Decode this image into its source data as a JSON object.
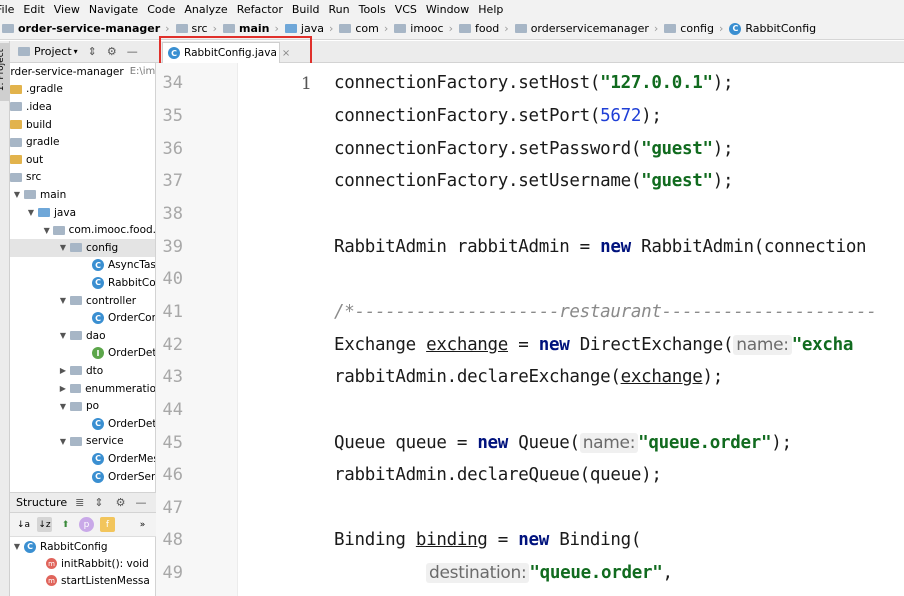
{
  "menu": [
    "File",
    "Edit",
    "View",
    "Navigate",
    "Code",
    "Analyze",
    "Refactor",
    "Build",
    "Run",
    "Tools",
    "VCS",
    "Window",
    "Help"
  ],
  "breadcrumb": [
    "order-service-manager",
    "src",
    "main",
    "java",
    "com",
    "imooc",
    "food",
    "orderservicemanager",
    "config",
    "RabbitConfig"
  ],
  "project": {
    "title": "Project",
    "root_name": "order-service-manager",
    "root_path": "E:\\imo",
    "tree": [
      {
        "label": ".gradle",
        "icon": "folder-orange"
      },
      {
        "label": ".idea",
        "icon": "folder-gray"
      },
      {
        "label": "build",
        "icon": "folder-orange"
      },
      {
        "label": "gradle",
        "icon": "folder-gray"
      },
      {
        "label": "out",
        "icon": "folder-orange"
      },
      {
        "label": "src",
        "icon": "folder-gray"
      },
      {
        "label": "main",
        "icon": "folder-gray"
      },
      {
        "label": "java",
        "icon": "folder-blue"
      },
      {
        "label": "com.imooc.food.",
        "icon": "package"
      },
      {
        "label": "config",
        "icon": "package"
      },
      {
        "label": "AsyncTask",
        "icon": "class"
      },
      {
        "label": "RabbitCor",
        "icon": "class"
      },
      {
        "label": "controller",
        "icon": "package"
      },
      {
        "label": "OrderCon",
        "icon": "class"
      },
      {
        "label": "dao",
        "icon": "package"
      },
      {
        "label": "OrderDeta",
        "icon": "interface"
      },
      {
        "label": "dto",
        "icon": "package"
      },
      {
        "label": "enummeratio",
        "icon": "package"
      },
      {
        "label": "po",
        "icon": "package"
      },
      {
        "label": "OrderDeta",
        "icon": "class"
      },
      {
        "label": "service",
        "icon": "package"
      },
      {
        "label": "OrderMes",
        "icon": "class"
      },
      {
        "label": "OrderServ",
        "icon": "class"
      }
    ]
  },
  "structure": {
    "title": "Structure",
    "class_name": "RabbitConfig",
    "members": [
      "initRabbit(): void",
      "startListenMessa"
    ]
  },
  "editor": {
    "tab_label": "RabbitConfig.java",
    "line_numbers": [
      "34",
      "35",
      "36",
      "37",
      "38",
      "39",
      "40",
      "41",
      "42",
      "43",
      "44",
      "45",
      "46",
      "47",
      "48",
      "49"
    ],
    "line_marker": "1",
    "code": {
      "l34": {
        "a": "connectionFactory.setHost(",
        "s": "\"127.0.0.1\"",
        "b": ");"
      },
      "l35": {
        "a": "connectionFactory.setPort(",
        "n": "5672",
        "b": ");"
      },
      "l36": {
        "a": "connectionFactory.setPassword(",
        "s": "\"guest\"",
        "b": ");"
      },
      "l37": {
        "a": "connectionFactory.setUsername(",
        "s": "\"guest\"",
        "b": ");"
      },
      "l39": {
        "a": "RabbitAdmin rabbitAdmin = ",
        "kw": "new",
        "b": " RabbitAdmin(connection"
      },
      "l41": {
        "c": "/*--------------------restaurant---------------------"
      },
      "l42": {
        "a": "Exchange ",
        "u": "exchange",
        "eq": " = ",
        "kw": "new",
        "b": " DirectExchange(",
        "h": "name:",
        "s": "\"excha"
      },
      "l43": {
        "a": "rabbitAdmin.declareExchange(",
        "u": "exchange",
        "b": ");"
      },
      "l45": {
        "a": "Queue queue = ",
        "kw": "new",
        "b": " Queue(",
        "h": "name:",
        "s": "\"queue.order\"",
        "e": ");"
      },
      "l46": {
        "a": "rabbitAdmin.declareQueue(queue);"
      },
      "l48": {
        "a": "Binding ",
        "u": "binding",
        "eq": " = ",
        "kw": "new",
        "b": " Binding("
      },
      "l49": {
        "h": "destination:",
        "s": "\"queue.order\"",
        "b": ","
      }
    }
  }
}
